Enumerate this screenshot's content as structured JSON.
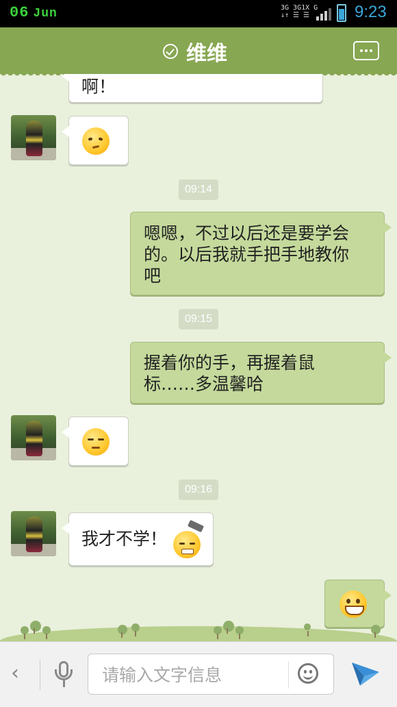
{
  "status_bar": {
    "date_day": "06",
    "date_month": "Jun",
    "network_label": "3G 3G 1X G",
    "time": "9:23",
    "colors": {
      "date": "#3bd23b",
      "time": "#3aa6d9"
    }
  },
  "header": {
    "title": "维维",
    "menu_icon": "more-dots-icon",
    "status_icon": "check-circle-icon",
    "bg_color": "#87a752"
  },
  "messages": [
    {
      "type": "text",
      "side": "in",
      "text": "啊！"
    },
    {
      "type": "emoji",
      "side": "in",
      "emoji": "smirk-emoji"
    },
    {
      "type": "timestamp",
      "text": "09:14"
    },
    {
      "type": "text",
      "side": "out",
      "lines": [
        "嗯嗯，不过以后还是要学会",
        "的。以后我就手把手地教你",
        "吧"
      ]
    },
    {
      "type": "timestamp",
      "text": "09:15"
    },
    {
      "type": "text",
      "side": "out",
      "lines": [
        "握着你的手，再握着鼠",
        "标……多温馨哈"
      ]
    },
    {
      "type": "emoji",
      "side": "in",
      "emoji": "grumpy-emoji"
    },
    {
      "type": "timestamp",
      "text": "09:16"
    },
    {
      "type": "text",
      "side": "in",
      "text": "我才不学！",
      "emoji": "hammer-emoji"
    },
    {
      "type": "emoji",
      "side": "out",
      "emoji": "grin-emoji"
    }
  ],
  "input_bar": {
    "placeholder": "请输入文字信息",
    "left_icon": "chevron-left-icon",
    "voice_icon": "microphone-icon",
    "emoji_icon": "smiley-icon",
    "send_icon": "send-icon"
  }
}
